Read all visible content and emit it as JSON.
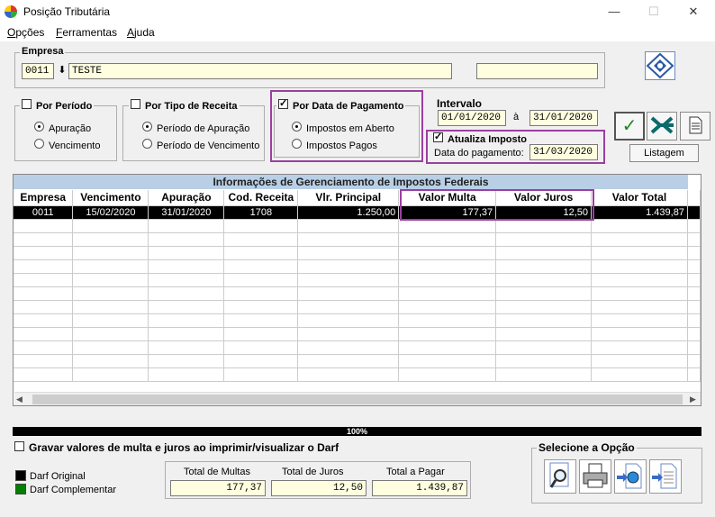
{
  "window": {
    "title": "Posição Tributária",
    "minimize": "—",
    "maximize": "☐",
    "close": "✕"
  },
  "menu": [
    {
      "label": "Opções",
      "ul": "O"
    },
    {
      "label": "Ferramentas",
      "ul": "F"
    },
    {
      "label": "Ajuda",
      "ul": "A"
    }
  ],
  "empresa": {
    "legend": "Empresa",
    "code": "0011",
    "name": "TESTE",
    "extra": ""
  },
  "por_periodo": {
    "label": "Por Período",
    "checked": false,
    "options": [
      "Apuração",
      "Vencimento"
    ],
    "selected": 0
  },
  "por_tipo": {
    "label": "Por Tipo de Receita",
    "checked": false,
    "options": [
      "Período de Apuração",
      "Período de Vencimento"
    ],
    "selected": 0
  },
  "por_data": {
    "label": "Por Data de Pagamento",
    "checked": true,
    "options": [
      "Impostos em Aberto",
      "Impostos Pagos"
    ],
    "selected": 0
  },
  "intervalo": {
    "legend": "Intervalo",
    "from": "01/01/2020",
    "sep": "à",
    "to": "31/01/2020"
  },
  "atualiza": {
    "label": "Atualiza Imposto",
    "checked": true,
    "date_label": "Data do pagamento:",
    "date": "31/03/2020"
  },
  "buttons": {
    "listagem": "Listagem"
  },
  "grid": {
    "title": "Informações de Gerenciamento de Impostos Federais",
    "columns": [
      "Empresa",
      "Vencimento",
      "Apuração",
      "Cod. Receita",
      "Vlr. Principal",
      "Valor Multa",
      "Valor Juros",
      "Valor Total"
    ],
    "rows": [
      [
        "0011",
        "15/02/2020",
        "31/01/2020",
        "1708",
        "1.250,00",
        "177,37",
        "12,50",
        "1.439,87"
      ]
    ]
  },
  "progress": "100%",
  "gravar": {
    "label": "Gravar valores de multa e juros ao imprimir/visualizar o Darf",
    "checked": false
  },
  "darf_legend": [
    {
      "label": "Darf Original",
      "color": "#000000"
    },
    {
      "label": "Darf Complementar",
      "color": "#008000"
    }
  ],
  "totals": {
    "multas_label": "Total de Multas",
    "multas": "177,37",
    "juros_label": "Total de Juros",
    "juros": "12,50",
    "pagar_label": "Total a Pagar",
    "pagar": "1.439,87"
  },
  "selecione": {
    "legend": "Selecione a Opção",
    "tools": [
      "magnifier-icon",
      "printer-icon",
      "globe-export-icon",
      "document-export-icon"
    ]
  },
  "colors": {
    "highlight": "#9b3fa0",
    "grid_header": "#b8cfe6",
    "field_bg": "#ffffe0"
  }
}
